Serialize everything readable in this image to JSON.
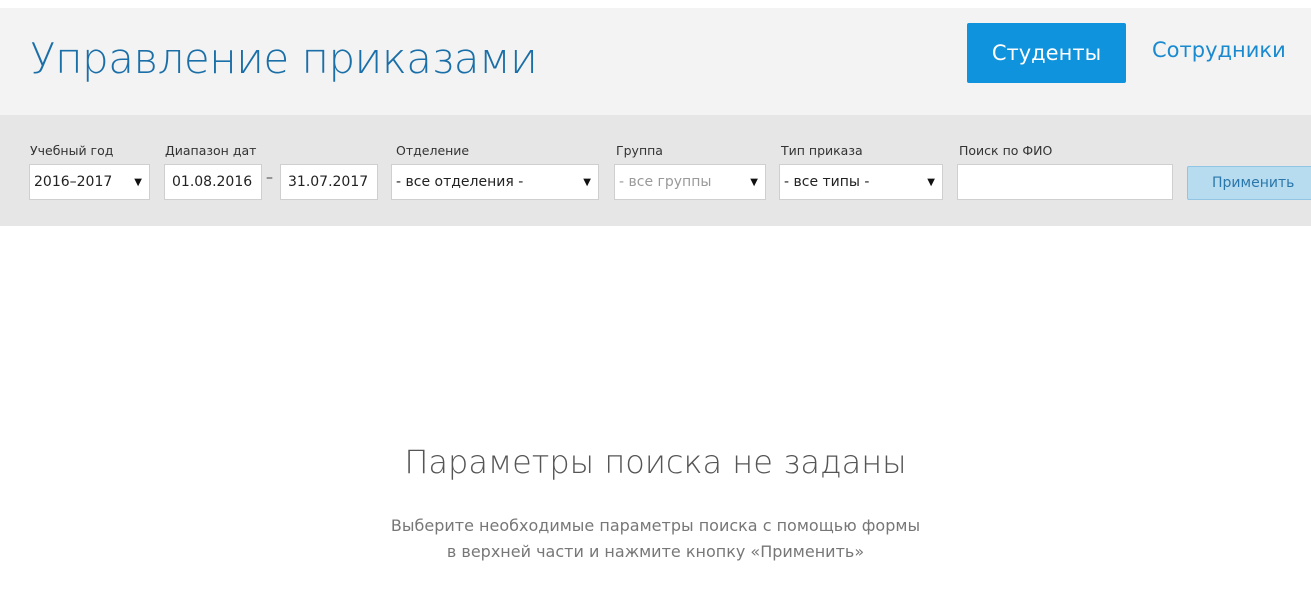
{
  "header": {
    "title": "Управление приказами",
    "tabs": [
      {
        "label": "Студенты",
        "active": true
      },
      {
        "label": "Сотрудники",
        "active": false
      }
    ]
  },
  "filters": {
    "academic_year": {
      "label": "Учебный год",
      "value": "2016–2017"
    },
    "date_range": {
      "label": "Диапазон дат",
      "from": "01.08.2016",
      "separator": "–",
      "to": "31.07.2017"
    },
    "department": {
      "label": "Отделение",
      "value": "- все отделения -"
    },
    "group": {
      "label": "Группа",
      "value": "- все группы"
    },
    "order_type": {
      "label": "Тип приказа",
      "value": "- все типы -"
    },
    "name_search": {
      "label": "Поиск по ФИО",
      "value": ""
    },
    "apply_label": "Применить"
  },
  "empty_state": {
    "title": "Параметры поиска не заданы",
    "line1": "Выберите необходимые параметры поиска с помощью формы",
    "line2": "в верхней части и нажмите кнопку «Применить»"
  },
  "colors": {
    "title": "#1b6fa8",
    "active_tab": "#0f93dc",
    "link": "#1a8ad0",
    "filter_bar": "#e6e6e6",
    "apply_button": "#b7dcf0"
  }
}
